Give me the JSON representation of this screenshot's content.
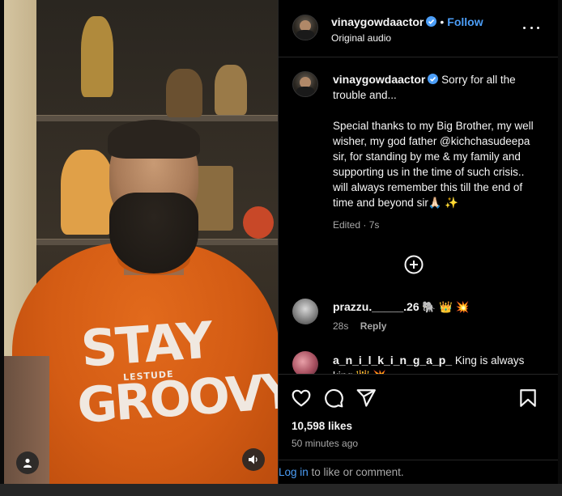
{
  "post": {
    "username": "vinaygowdaactor",
    "subtitle": "Original audio",
    "follow_label": "Follow",
    "dot": "•",
    "caption_line1": "Sorry for all the trouble and...",
    "caption_body": "Special thanks to my Big Brother, my well wisher, my god father @kichchasudeepa sir, for standing by me & my family and supporting us in the time of such crisis.. will always remember this till the end of time and beyond sir🙏🏻 ✨",
    "caption_meta": "Edited · 7s",
    "shirt_print_top": "STAY",
    "shirt_print_mid": "LESTUDE",
    "shirt_print_bottom": "GROOVY"
  },
  "comments": [
    {
      "username": "prazzu._____.26",
      "text": "🐘 👑 💥",
      "time": "28s",
      "reply_label": "Reply"
    },
    {
      "username": "a_n_i_l_k_i_n_g_a_p_",
      "text": "King is always king 👑 💥"
    }
  ],
  "stats": {
    "likes": "10,598 likes",
    "time_ago": "50 minutes ago"
  },
  "footer": {
    "login_link": "Log in",
    "login_rest": " to like or comment."
  },
  "colors": {
    "accent": "#4c9ef7",
    "background": "#000000",
    "divider": "#262626",
    "shirt": "#d45c14"
  }
}
